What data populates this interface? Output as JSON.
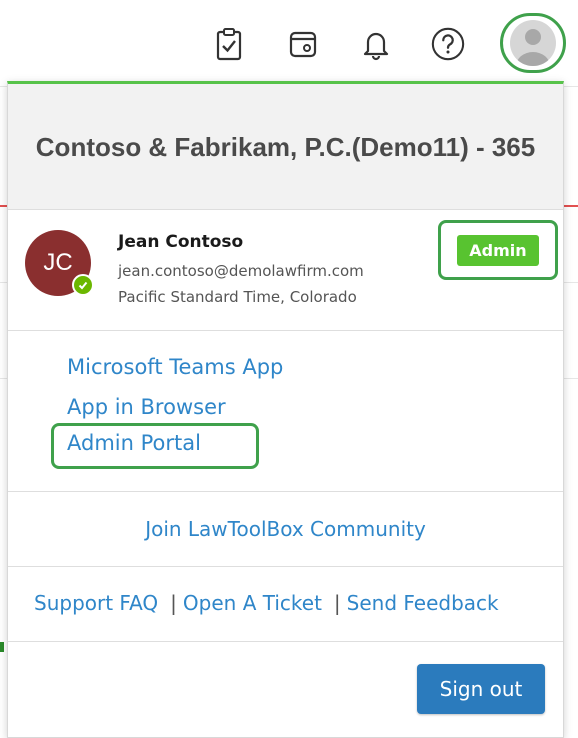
{
  "topbar": {
    "icons": [
      "clipboard-check-icon",
      "calendar-event-icon",
      "bell-icon",
      "help-icon",
      "user-avatar-icon"
    ]
  },
  "popover": {
    "org_name": "Contoso & Fabrikam, P.C.(Demo11) - 365",
    "user": {
      "initials": "JC",
      "name": "Jean Contoso",
      "email": "jean.contoso@demolawfirm.com",
      "timezone": "Pacific Standard Time, Colorado",
      "role_badge": "Admin",
      "presence": "available"
    },
    "links": {
      "teams_app": "Microsoft Teams App",
      "app_in_browser": "App in Browser",
      "admin_portal": "Admin Portal"
    },
    "community_link": "Join LawToolBox Community",
    "support": {
      "faq": "Support FAQ",
      "separator": "|",
      "ticket": "Open A Ticket",
      "feedback": "Send Feedback"
    },
    "sign_out": "Sign out"
  },
  "colors": {
    "accent_green": "#3fa14b",
    "link_blue": "#2f86c9",
    "button_blue": "#2b7bbd",
    "admin_badge_green": "#58c330",
    "avatar_maroon": "#8a2f2f"
  }
}
